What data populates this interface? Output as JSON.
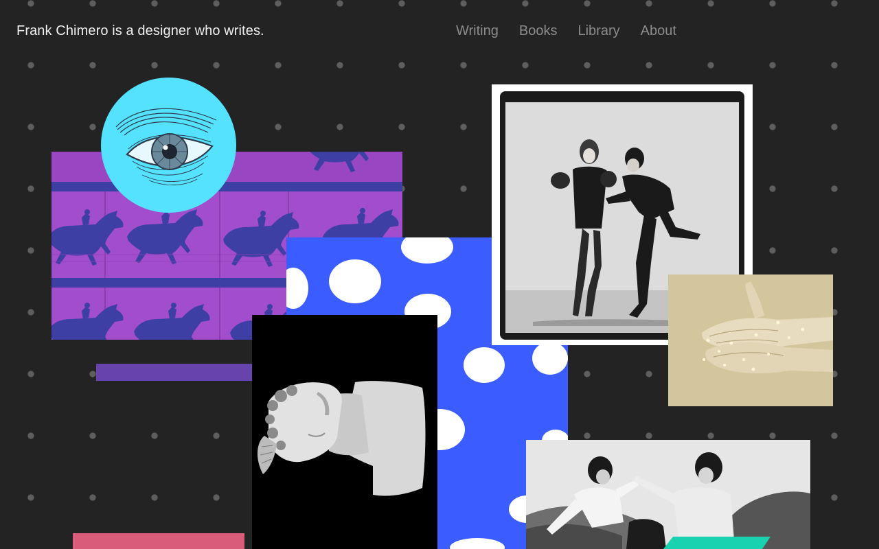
{
  "header": {
    "tagline": "Frank Chimero is a designer who writes."
  },
  "nav": {
    "items": [
      {
        "label": "Writing"
      },
      {
        "label": "Books"
      },
      {
        "label": "Library"
      },
      {
        "label": "About"
      }
    ]
  },
  "colors": {
    "background": "#232323",
    "dot": "#5e5e5e",
    "nav_text": "#8c8c8c",
    "tagline_text": "#f0f0f0",
    "eye_circle": "#55e2ff",
    "horse_magenta": "#a24dcb",
    "horse_blue": "#3d3fa5",
    "purple_bar": "#6643ad",
    "dots_blue": "#3b5dff",
    "pink_bar": "#d95c7b",
    "teal_accent": "#19d3b0",
    "hands_sepia": "#d7cba4"
  },
  "collage": {
    "tiles": [
      {
        "icon": "horse-motion-film-image"
      },
      {
        "icon": "engraved-eye-image"
      },
      {
        "icon": "purple-bar-shape"
      },
      {
        "icon": "blue-white-dots-pattern"
      },
      {
        "icon": "classical-bust-image"
      },
      {
        "icon": "dancers-photo"
      },
      {
        "icon": "hands-photo"
      },
      {
        "icon": "fighters-photo"
      },
      {
        "icon": "pink-bar-shape"
      }
    ]
  }
}
